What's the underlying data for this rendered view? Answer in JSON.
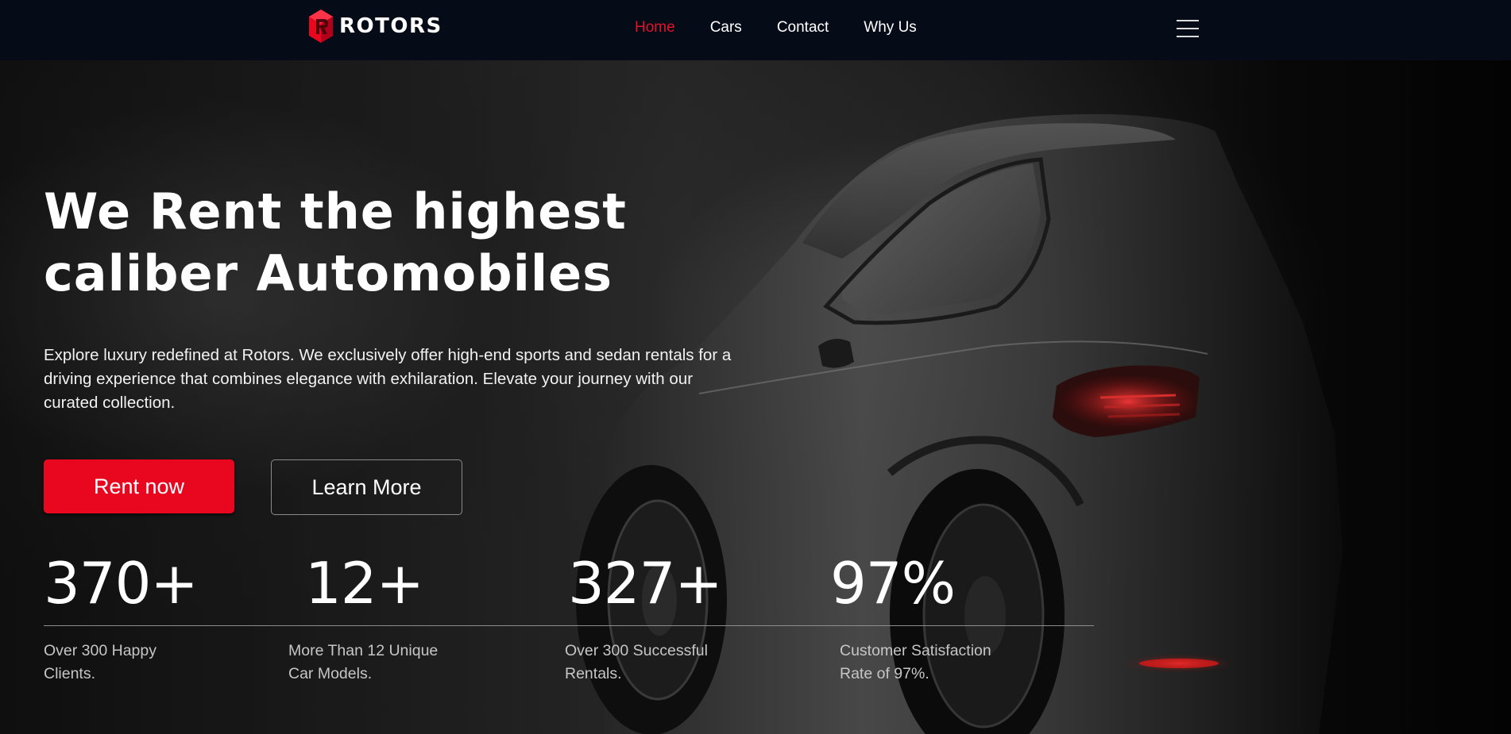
{
  "brand": {
    "name": "ROTORS",
    "logo_icon": "rotors-hexagon-logo-icon",
    "accent_color": "#e8071f"
  },
  "nav": {
    "items": [
      {
        "label": "Home",
        "active": true
      },
      {
        "label": "Cars",
        "active": false
      },
      {
        "label": "Contact",
        "active": false
      },
      {
        "label": "Why Us",
        "active": false
      }
    ],
    "menu_icon": "hamburger-menu-icon"
  },
  "hero": {
    "title_line1": "We Rent the highest",
    "title_line2": "caliber Automobiles",
    "description": "Explore luxury redefined at Rotors. We exclusively offer high-end sports and sedan rentals for a driving experience that combines elegance with exhilaration. Elevate your journey with our curated collection.",
    "primary_button": "Rent now",
    "secondary_button": "Learn More",
    "background_image": "dark-sports-car-photo"
  },
  "stats": [
    {
      "value": "370+",
      "label_line1": "Over 300 Happy",
      "label_line2": "Clients."
    },
    {
      "value": "12+",
      "label_line1": "More Than 12 Unique",
      "label_line2": "Car Models."
    },
    {
      "value": "327+",
      "label_line1": "Over 300 Successful",
      "label_line2": "Rentals."
    },
    {
      "value": "97%",
      "label_line1": "Customer Satisfaction",
      "label_line2": "Rate of 97%."
    }
  ]
}
